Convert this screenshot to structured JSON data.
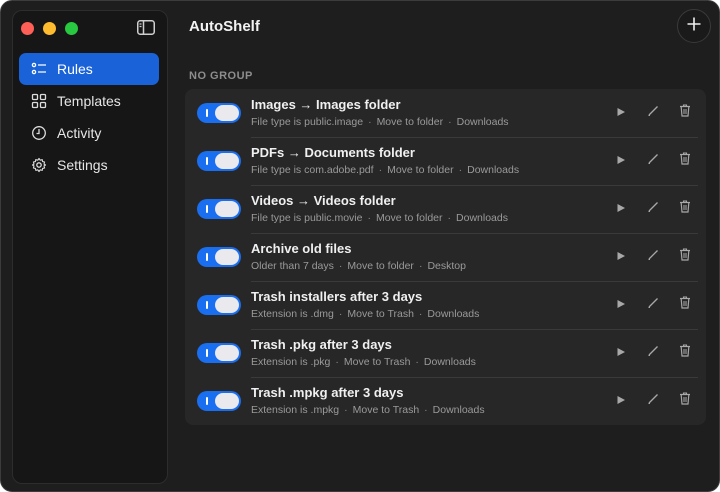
{
  "app": {
    "title": "AutoShelf"
  },
  "sidebar": {
    "items": [
      {
        "label": "Rules",
        "icon": "rules-list-icon",
        "active": true
      },
      {
        "label": "Templates",
        "icon": "grid-icon",
        "active": false
      },
      {
        "label": "Activity",
        "icon": "clock-icon",
        "active": false
      },
      {
        "label": "Settings",
        "icon": "gear-icon",
        "active": false
      }
    ]
  },
  "group": {
    "label": "NO GROUP"
  },
  "rules": [
    {
      "title": "Images → Images folder",
      "condition": "File type is public.image",
      "action": "Move to folder",
      "target": "Downloads",
      "enabled": true
    },
    {
      "title": "PDFs → Documents folder",
      "condition": "File type is com.adobe.pdf",
      "action": "Move to folder",
      "target": "Downloads",
      "enabled": true
    },
    {
      "title": "Videos → Videos folder",
      "condition": "File type is public.movie",
      "action": "Move to folder",
      "target": "Downloads",
      "enabled": true
    },
    {
      "title": "Archive old files",
      "condition": "Older than 7 days",
      "action": "Move to folder",
      "target": "Desktop",
      "enabled": true
    },
    {
      "title": "Trash installers after 3 days",
      "condition": "Extension is .dmg",
      "action": "Move to Trash",
      "target": "Downloads",
      "enabled": true
    },
    {
      "title": "Trash .pkg after 3 days",
      "condition": "Extension is .pkg",
      "action": "Move to Trash",
      "target": "Downloads",
      "enabled": true
    },
    {
      "title": "Trash .mpkg after 3 days",
      "condition": "Extension is .mpkg",
      "action": "Move to Trash",
      "target": "Downloads",
      "enabled": true
    }
  ],
  "meta_separator": "·",
  "colors": {
    "accent": "#1a62d8",
    "toggle_on": "#1a6ff0",
    "close": "#fe5f57",
    "minimize": "#febc2e",
    "zoom": "#28c840"
  }
}
